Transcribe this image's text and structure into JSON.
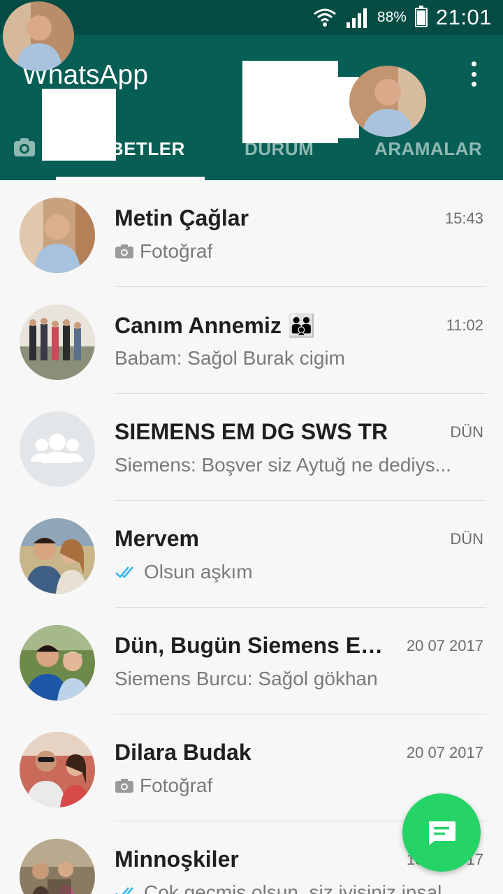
{
  "status_bar": {
    "battery": "88%",
    "time": "21:01"
  },
  "app": {
    "title": "WhatsApp"
  },
  "tabs": [
    {
      "label": "SOHBETLER"
    },
    {
      "label": "DURUM"
    },
    {
      "label": "ARAMALAR"
    }
  ],
  "chats": [
    {
      "name": "Metin Çağlar",
      "time": "15:43",
      "preview": "Fotoğraf",
      "preview_icon": "camera-icon"
    },
    {
      "name": "Canım Annemiz 👪",
      "time": "11:02",
      "preview": "Babam: Sağol Burak cigim",
      "preview_icon": ""
    },
    {
      "name": "SIEMENS EM DG SWS TR",
      "time": "DÜN",
      "preview": "Siemens: Boşver siz Aytuğ ne dediys...",
      "preview_icon": ""
    },
    {
      "name": "Mervem",
      "time": "DÜN",
      "preview": "Olsun aşkım",
      "preview_icon": "double-check-icon"
    },
    {
      "name": "Dün, Bugün Siemens EM...",
      "time": "20 07 2017",
      "preview": "Siemens Burcu: Sağol gökhan",
      "preview_icon": ""
    },
    {
      "name": "Dilara Budak",
      "time": "20 07 2017",
      "preview": "Fotoğraf",
      "preview_icon": "camera-icon"
    },
    {
      "name": "Minnoşkiler",
      "time": "18 07 2017",
      "preview": "Çok geçmiş olsun, siz iyisiniz inşal...",
      "preview_icon": "double-check-icon"
    }
  ],
  "colors": {
    "header": "#075e54",
    "status_bar": "#054d44",
    "fab": "#25d366",
    "read_tick": "#34b7f1"
  }
}
